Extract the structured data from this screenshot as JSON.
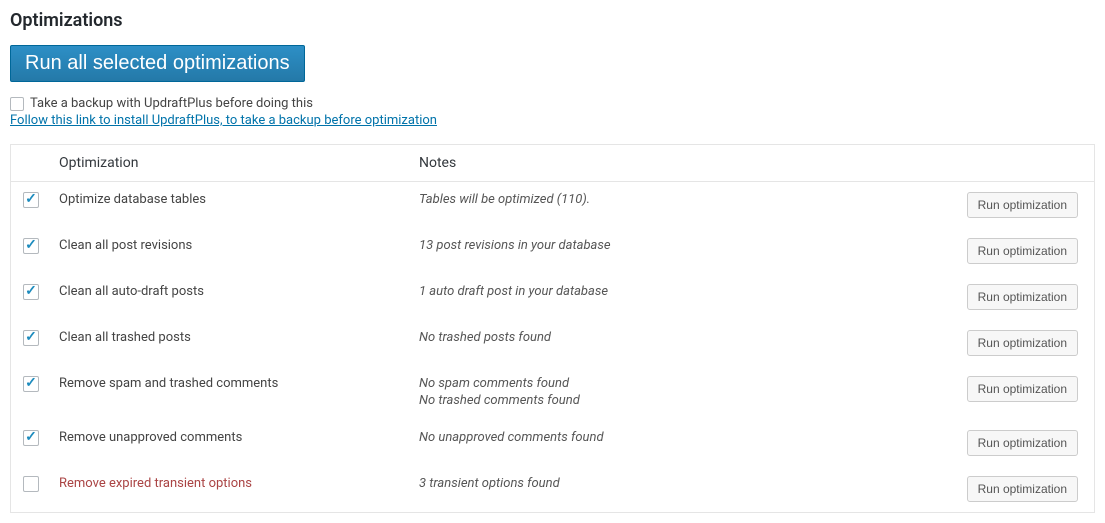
{
  "heading": "Optimizations",
  "run_all_label": "Run all selected optimizations",
  "backup_checkbox_label": "Take a backup with UpdraftPlus before doing this",
  "install_link": "Follow this link to install UpdraftPlus, to take a backup before optimization",
  "columns": {
    "optimization": "Optimization",
    "notes": "Notes"
  },
  "run_optimization_label": "Run optimization",
  "rows": [
    {
      "checked": true,
      "name": "Optimize database tables",
      "notes": [
        "Tables will be optimized (110)."
      ],
      "warn": false
    },
    {
      "checked": true,
      "name": "Clean all post revisions",
      "notes": [
        "13 post revisions in your database"
      ],
      "warn": false
    },
    {
      "checked": true,
      "name": "Clean all auto-draft posts",
      "notes": [
        "1 auto draft post in your database"
      ],
      "warn": false
    },
    {
      "checked": true,
      "name": "Clean all trashed posts",
      "notes": [
        "No trashed posts found"
      ],
      "warn": false
    },
    {
      "checked": true,
      "name": "Remove spam and trashed comments",
      "notes": [
        "No spam comments found",
        "No trashed comments found"
      ],
      "warn": false
    },
    {
      "checked": true,
      "name": "Remove unapproved comments",
      "notes": [
        "No unapproved comments found"
      ],
      "warn": false
    },
    {
      "checked": false,
      "name": "Remove expired transient options",
      "notes": [
        "3 transient options found"
      ],
      "warn": true
    }
  ]
}
